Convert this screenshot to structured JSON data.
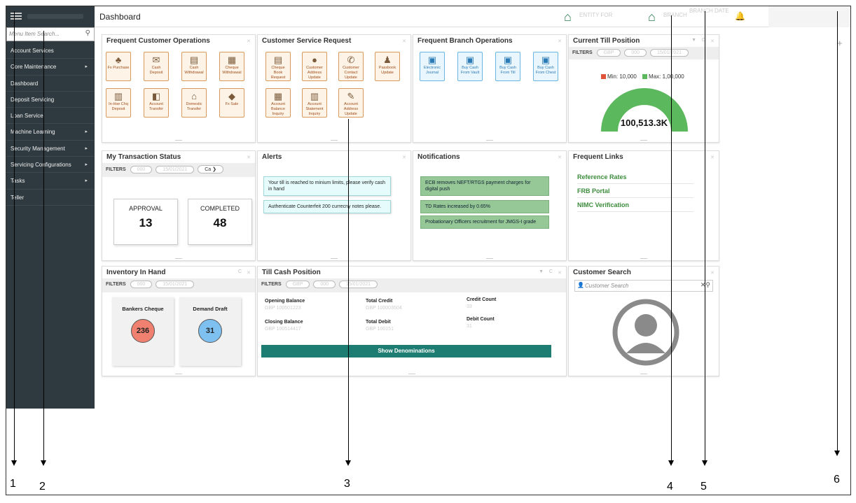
{
  "topbar": {
    "title": "Dashboard",
    "entity_faded": "ENTITY FOR",
    "branch_faded": "BRANCH",
    "date_faded": "BRANCH DATE"
  },
  "sidebar": {
    "search_placeholder": "Menu Item Search...",
    "items": [
      {
        "label": "Account Services",
        "arrow": ""
      },
      {
        "label": "Core Maintenance",
        "arrow": "▸"
      },
      {
        "label": "Dashboard",
        "arrow": ""
      },
      {
        "label": "Deposit Servicing",
        "arrow": ""
      },
      {
        "label": "Loan Service",
        "arrow": ""
      },
      {
        "label": "Machine Learning",
        "arrow": "▸"
      },
      {
        "label": "Security Management",
        "arrow": "▸"
      },
      {
        "label": "Servicing Configurations",
        "arrow": "▸"
      },
      {
        "label": "Tasks",
        "arrow": "▸"
      },
      {
        "label": "Teller",
        "arrow": ""
      }
    ]
  },
  "widgets": {
    "frequent_customer_ops": {
      "title": "Frequent Customer Operations",
      "tiles": [
        {
          "label": "Fx Purchase",
          "icon": "♣"
        },
        {
          "label": "Cash Deposit",
          "icon": "✉"
        },
        {
          "label": "Cash Withdrawal",
          "icon": "▤"
        },
        {
          "label": "Cheque Withdrawal",
          "icon": "▦"
        },
        {
          "label": "In-Hse Chq Deposit",
          "icon": "▥"
        },
        {
          "label": "Account Transfer",
          "icon": "◧"
        },
        {
          "label": "Domestic Transfer",
          "icon": "⌂"
        },
        {
          "label": "Fx Sale",
          "icon": "◆"
        }
      ]
    },
    "customer_service_request": {
      "title": "Customer Service Request",
      "tiles": [
        {
          "label": "Cheque Book Request",
          "icon": "▤"
        },
        {
          "label": "Customer Address Update",
          "icon": "●"
        },
        {
          "label": "Customer Contact Update",
          "icon": "✆"
        },
        {
          "label": "Passbook Update",
          "icon": "♟"
        },
        {
          "label": "Account Balance Inquiry",
          "icon": "▦"
        },
        {
          "label": "Account Statement Inquiry",
          "icon": "▥"
        },
        {
          "label": "Account Address Update",
          "icon": "✎"
        }
      ]
    },
    "frequent_branch_ops": {
      "title": "Frequent Branch Operations",
      "tiles": [
        {
          "label": "Electronic Journal",
          "icon": "▣"
        },
        {
          "label": "Buy Cash From Vault",
          "icon": "▣"
        },
        {
          "label": "Buy Cash From Till",
          "icon": "▣"
        },
        {
          "label": "Buy Cash From Chest",
          "icon": "▣"
        }
      ]
    },
    "current_till": {
      "title": "Current Till Position",
      "filters_label": "FILTERS",
      "filter_pills": [
        "GBP",
        "000",
        "15/01/2021"
      ],
      "legend_min": "Min: 10,000",
      "legend_max": "Max: 1,00,000",
      "value": "100,513.3K",
      "fill_fraction": 1.0,
      "colors": {
        "min": "#e0523a",
        "max": "#5cb85c"
      }
    },
    "my_transaction_status": {
      "title": "My Transaction Status",
      "filters_label": "FILTERS",
      "filter_pills": [
        "000",
        "15/01/2021"
      ],
      "next_pill": "Ca",
      "approval_label": "APPROVAL",
      "approval_value": "13",
      "completed_label": "COMPLETED",
      "completed_value": "48"
    },
    "alerts": {
      "title": "Alerts",
      "items": [
        "Your till is reached to minium limits, please verify cash in hand",
        "Authenticate Counterfeit 200 currecny notes please."
      ]
    },
    "notifications": {
      "title": "Notifications",
      "items": [
        "ECB removes NEFT/RTGS payment charges for digital push",
        "TD Rates increased by 0.65%",
        "Probationary Officers recruitment for JMGS-I grade"
      ]
    },
    "frequent_links": {
      "title": "Frequent Links",
      "items": [
        "Reference Rates",
        "FRB Portal",
        "NIMC Verification"
      ]
    },
    "inventory_in_hand": {
      "title": "Inventory In Hand",
      "filters_label": "FILTERS",
      "filter_pills": [
        "000",
        "15/01/2021"
      ],
      "items": [
        {
          "label": "Bankers Cheque",
          "value": "236",
          "color": "#f08070"
        },
        {
          "label": "Demand Draft",
          "value": "31",
          "color": "#7ec0f0"
        }
      ]
    },
    "till_cash_position": {
      "title": "Till Cash Position",
      "filters_label": "FILTERS",
      "filter_pills": [
        "GBP",
        "000",
        "15/01/2021"
      ],
      "opening_balance_label": "Opening Balance",
      "opening_balance_value": "GBP 100501223",
      "closing_balance_label": "Closing Balance",
      "closing_balance_value": "GBP 100514417",
      "total_credit_label": "Total Credit",
      "total_credit_value": "GBP 100003504",
      "total_debit_label": "Total Debit",
      "total_debit_value": "GBP 100151",
      "credit_count_label": "Credit Count",
      "credit_count_value": "33",
      "debit_count_label": "Debit Count",
      "debit_count_value": "31",
      "button_label": "Show Denominations"
    },
    "customer_search": {
      "title": "Customer Search",
      "placeholder": "Customer Search"
    }
  },
  "callouts": [
    "1",
    "2",
    "3",
    "4",
    "5",
    "6"
  ]
}
